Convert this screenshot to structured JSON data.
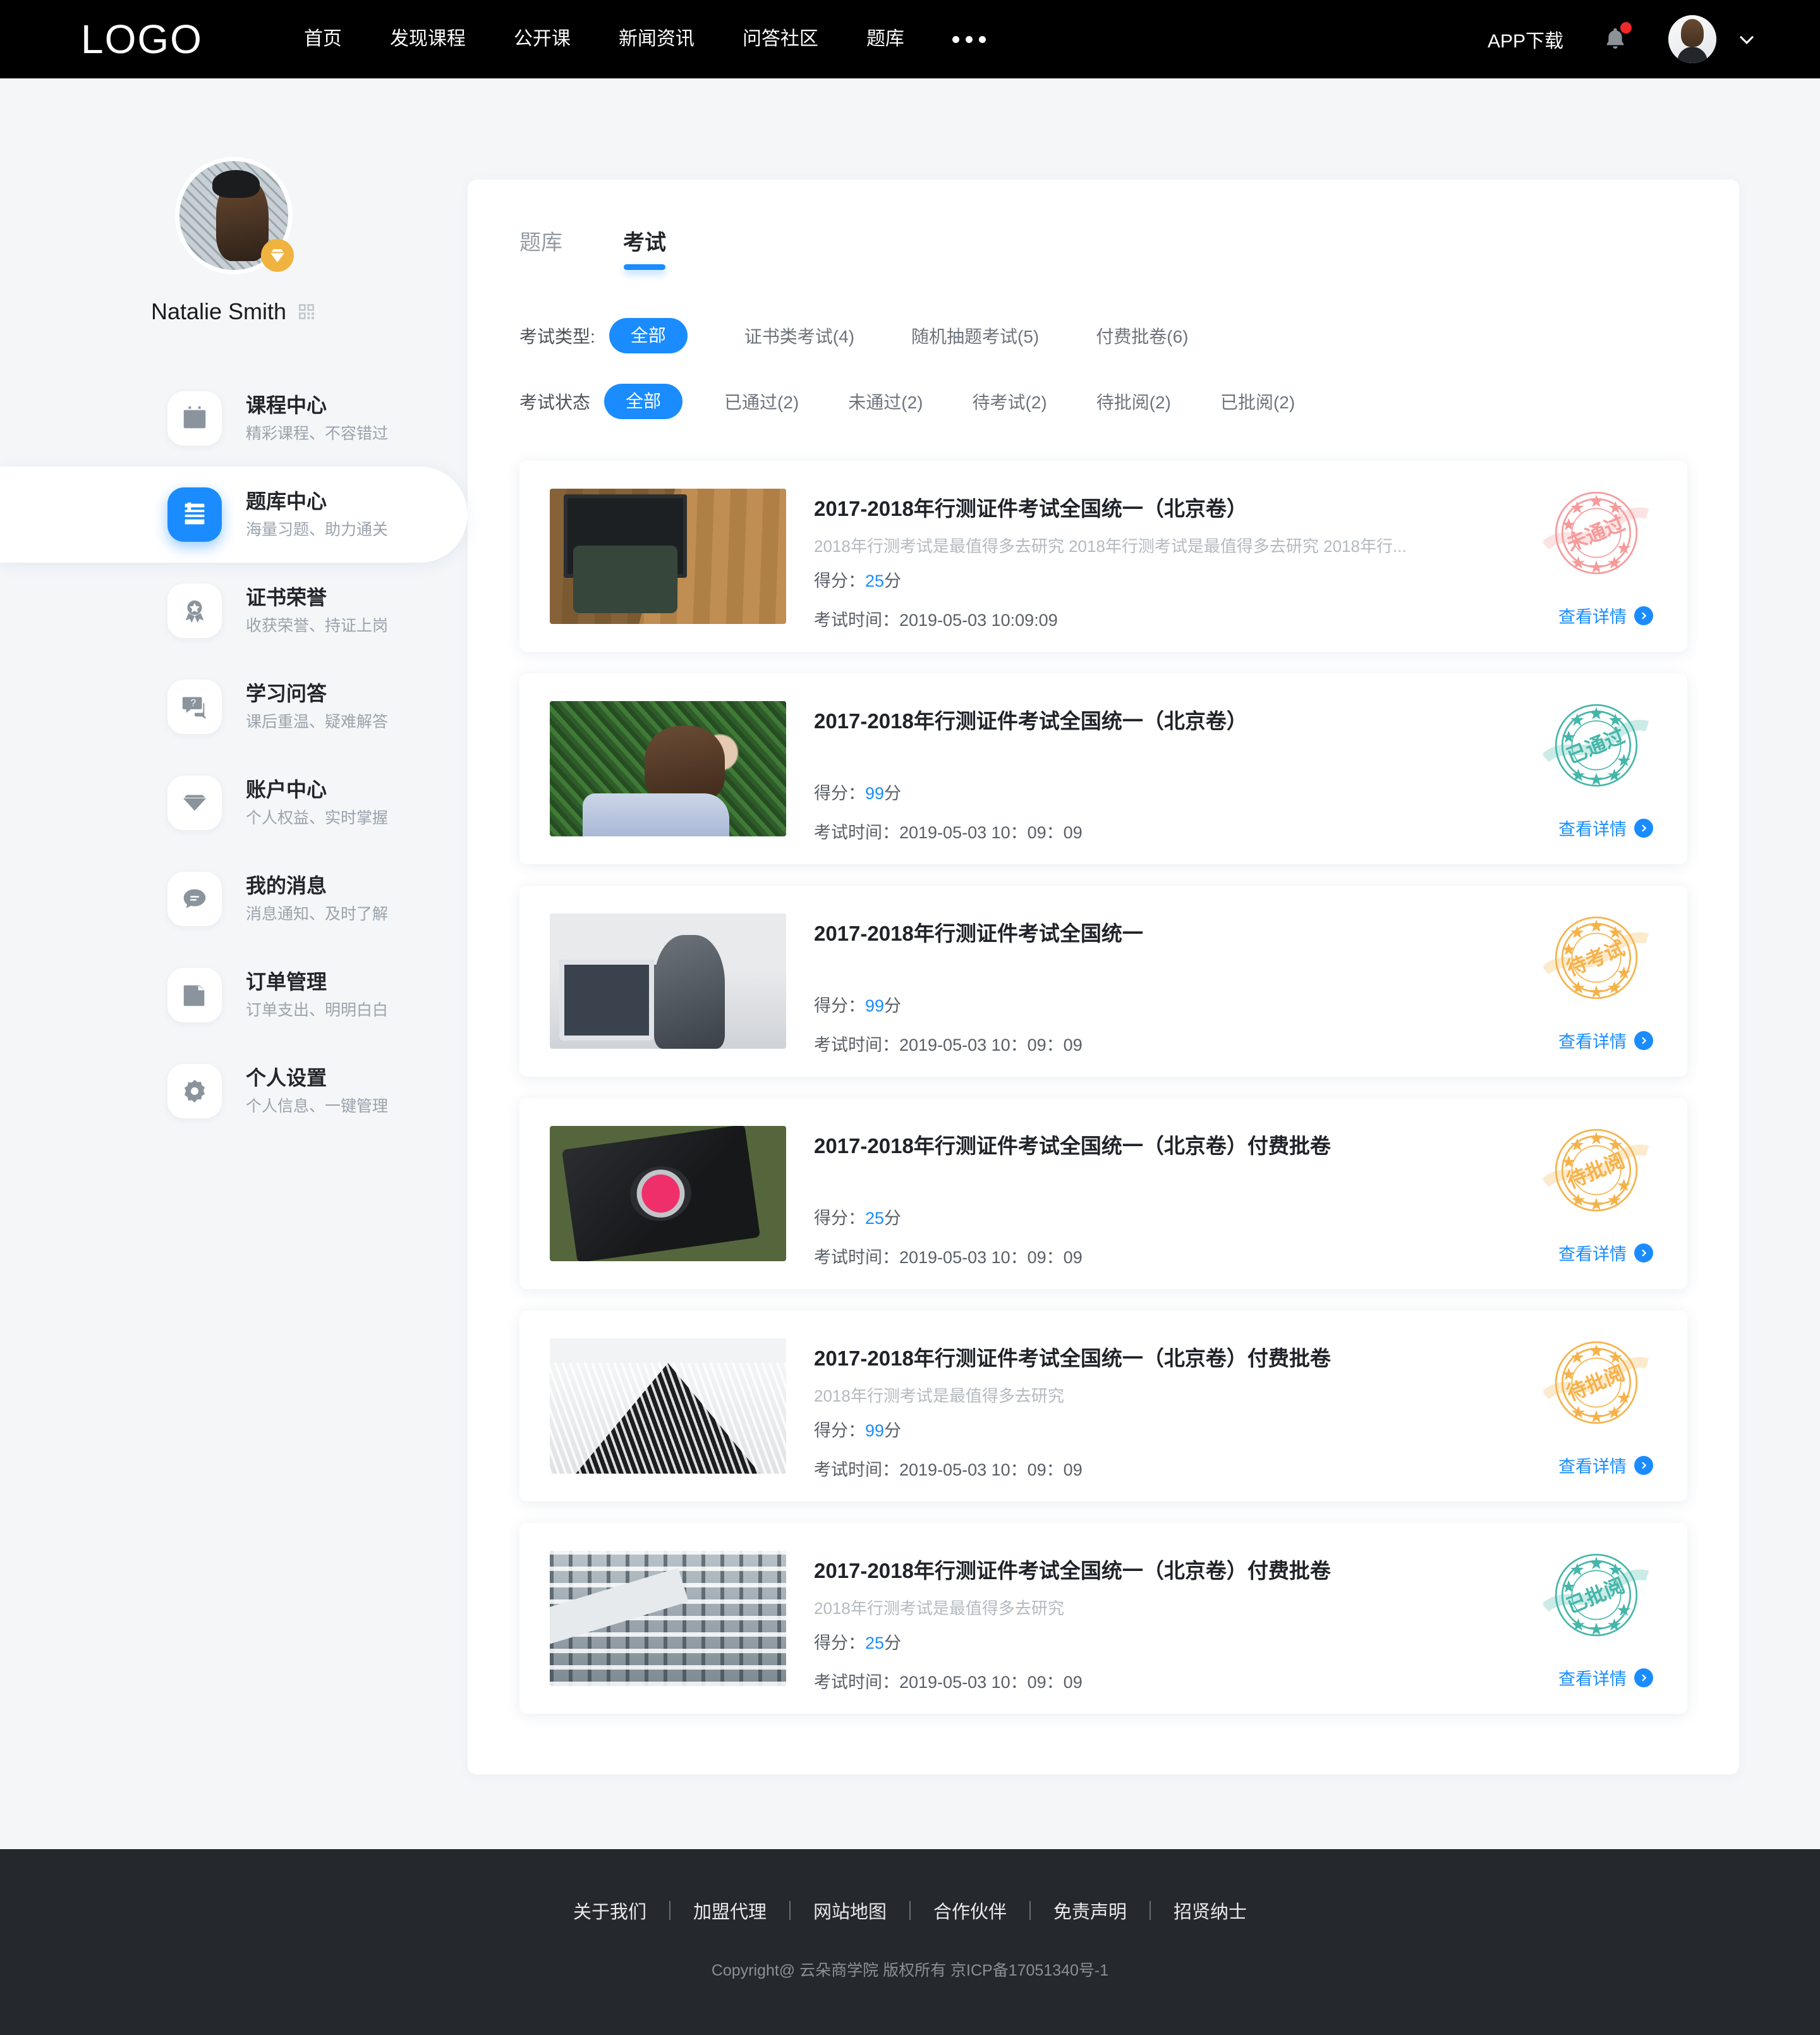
{
  "header": {
    "logo": "LOGO",
    "nav": [
      "首页",
      "发现课程",
      "公开课",
      "新闻资讯",
      "问答社区",
      "题库"
    ],
    "more_icon": "ellipsis-icon",
    "app_download": "APP下载",
    "bell_icon": "bell-icon",
    "has_notification": true,
    "avatar_icon": "user-avatar",
    "chevron_icon": "chevron-down-icon"
  },
  "sidebar": {
    "user_name": "Natalie Smith",
    "vip_icon": "diamond-icon",
    "qr_icon": "qrcode-icon",
    "items": [
      {
        "title": "课程中心",
        "sub": "精彩课程、不容错过",
        "icon": "calendar-icon",
        "active": false
      },
      {
        "title": "题库中心",
        "sub": "海量习题、助力通关",
        "icon": "book-icon",
        "active": true
      },
      {
        "title": "证书荣誉",
        "sub": "收获荣誉、持证上岗",
        "icon": "medal-icon",
        "active": false
      },
      {
        "title": "学习问答",
        "sub": "课后重温、疑难解答",
        "icon": "question-bubble-icon",
        "active": false
      },
      {
        "title": "账户中心",
        "sub": "个人权益、实时掌握",
        "icon": "diamond-icon",
        "active": false
      },
      {
        "title": "我的消息",
        "sub": "消息通知、及时了解",
        "icon": "chat-icon",
        "active": false
      },
      {
        "title": "订单管理",
        "sub": "订单支出、明明白白",
        "icon": "order-doc-icon",
        "active": false
      },
      {
        "title": "个人设置",
        "sub": "个人信息、一键管理",
        "icon": "gear-icon",
        "active": false
      }
    ]
  },
  "main": {
    "tabs": [
      {
        "label": "题库",
        "active": false
      },
      {
        "label": "考试",
        "active": true
      }
    ],
    "filters": [
      {
        "label": "考试类型:",
        "options": [
          {
            "label": "全部",
            "selected": true
          },
          {
            "label": "证书类考试(4)",
            "selected": false
          },
          {
            "label": "随机抽题考试(5)",
            "selected": false
          },
          {
            "label": "付费批卷(6)",
            "selected": false
          }
        ]
      },
      {
        "label": "考试状态",
        "options": [
          {
            "label": "全部",
            "selected": true
          },
          {
            "label": "已通过(2)",
            "selected": false
          },
          {
            "label": "未通过(2)",
            "selected": false
          },
          {
            "label": "待考试(2)",
            "selected": false
          },
          {
            "label": "待批阅(2)",
            "selected": false
          },
          {
            "label": "已批阅(2)",
            "selected": false
          }
        ]
      }
    ],
    "score_label": "得分：",
    "score_unit": "分",
    "time_label": "考试时间：",
    "detail_label": "查看详情",
    "cards": [
      {
        "title": "2017-2018年行测证件考试全国统一（北京卷）",
        "desc": "2018年行测考试是最值得多去研究 2018年行测考试是最值得多去研究 2018年行...",
        "score": "25",
        "time": "2019-05-03  10:09:09",
        "stamp": "未通过",
        "stamp_color": "#f69a9a",
        "thumb": "ph-desk"
      },
      {
        "title": "2017-2018年行测证件考试全国统一（北京卷）",
        "desc": "",
        "score": "99",
        "time": "2019-05-03  10：09：09",
        "stamp": "已通过",
        "stamp_color": "#45b6a9",
        "thumb": "ph-green"
      },
      {
        "title": "2017-2018年行测证件考试全国统一",
        "desc": "",
        "score": "99",
        "time": "2019-05-03  10：09：09",
        "stamp": "待考试",
        "stamp_color": "#f6b24a",
        "thumb": "ph-office"
      },
      {
        "title": "2017-2018年行测证件考试全国统一（北京卷）付费批卷",
        "desc": "",
        "score": "25",
        "time": "2019-05-03  10：09：09",
        "stamp": "待批阅",
        "stamp_color": "#f6b24a",
        "thumb": "ph-cam"
      },
      {
        "title": "2017-2018年行测证件考试全国统一（北京卷）付费批卷",
        "desc": "2018年行测考试是最值得多去研究",
        "score": "99",
        "time": "2019-05-03  10：09：09",
        "stamp": "待批阅",
        "stamp_color": "#f6b24a",
        "thumb": "ph-tower"
      },
      {
        "title": "2017-2018年行测证件考试全国统一（北京卷）付费批卷",
        "desc": "2018年行测考试是最值得多去研究",
        "score": "25",
        "time": "2019-05-03  10：09：09",
        "stamp": "已批阅",
        "stamp_color": "#45b6a9",
        "thumb": "ph-building"
      }
    ]
  },
  "footer": {
    "links": [
      "关于我们",
      "加盟代理",
      "网站地图",
      "合作伙伴",
      "免责声明",
      "招贤纳士"
    ],
    "copyright": "Copyright@ 云朵商学院   版权所有      京ICP备17051340号-1"
  },
  "colors": {
    "accent": "#1a8cff",
    "header_bg": "#000000",
    "page_bg": "#f4f6f8",
    "footer_bg": "#25282d",
    "vip": "#f0b33f"
  }
}
